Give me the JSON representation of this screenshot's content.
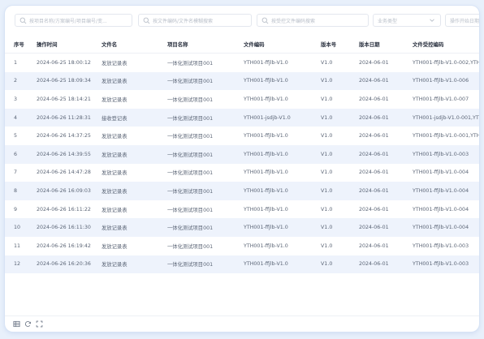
{
  "filters": {
    "project_placeholder": "按项目名称/方案编号/项目编号/变...",
    "file_placeholder": "按文件编码/文件名模糊搜索",
    "transfer_placeholder": "按受控文件编码搜索",
    "business_type_placeholder": "业务类型",
    "op_time_placeholder": "操作开始日期"
  },
  "table": {
    "headers": [
      "序号",
      "操作时间",
      "文件名",
      "项目名称",
      "文件编码",
      "版本号",
      "版本日期",
      "文件受控编码"
    ],
    "rows": [
      [
        "1",
        "2024-06-25 18:00:12",
        "发放记录表",
        "一体化测试项目001",
        "YTH001-ffjlb-V1.0",
        "V1.0",
        "2024-06-01",
        "YTH001-ffjlb-V1.0-002,YTH"
      ],
      [
        "2",
        "2024-06-25 18:09:34",
        "发放记录表",
        "一体化测试项目001",
        "YTH001-ffjlb-V1.0",
        "V1.0",
        "2024-06-01",
        "YTH001-ffjlb-V1.0-006"
      ],
      [
        "3",
        "2024-06-25 18:14:21",
        "发放记录表",
        "一体化测试项目001",
        "YTH001-ffjlb-V1.0",
        "V1.0",
        "2024-06-01",
        "YTH001-ffjlb-V1.0-007"
      ],
      [
        "4",
        "2024-06-26 11:28:31",
        "接收登记表",
        "一体化测试项目001",
        "YTH001-jsdjb-V1.0",
        "V1.0",
        "2024-06-01",
        "YTH001-jsdjb-V1.0-001,YTH"
      ],
      [
        "5",
        "2024-06-26 14:37:25",
        "发放记录表",
        "一体化测试项目001",
        "YTH001-ffjlb-V1.0",
        "V1.0",
        "2024-06-01",
        "YTH001-ffjlb-V1.0-001,YTH"
      ],
      [
        "6",
        "2024-06-26 14:39:55",
        "发放记录表",
        "一体化测试项目001",
        "YTH001-ffjlb-V1.0",
        "V1.0",
        "2024-06-01",
        "YTH001-ffjlb-V1.0-003"
      ],
      [
        "7",
        "2024-06-26 14:47:28",
        "发放记录表",
        "一体化测试项目001",
        "YTH001-ffjlb-V1.0",
        "V1.0",
        "2024-06-01",
        "YTH001-ffjlb-V1.0-004"
      ],
      [
        "8",
        "2024-06-26 16:09:03",
        "发放记录表",
        "一体化测试项目001",
        "YTH001-ffjlb-V1.0",
        "V1.0",
        "2024-06-01",
        "YTH001-ffjlb-V1.0-004"
      ],
      [
        "9",
        "2024-06-26 16:11:22",
        "发放记录表",
        "一体化测试项目001",
        "YTH001-ffjlb-V1.0",
        "V1.0",
        "2024-06-01",
        "YTH001-ffjlb-V1.0-004"
      ],
      [
        "10",
        "2024-06-26 16:11:30",
        "发放记录表",
        "一体化测试项目001",
        "YTH001-ffjlb-V1.0",
        "V1.0",
        "2024-06-01",
        "YTH001-ffjlb-V1.0-004"
      ],
      [
        "11",
        "2024-06-26 16:19:42",
        "发放记录表",
        "一体化测试项目001",
        "YTH001-ffjlb-V1.0",
        "V1.0",
        "2024-06-01",
        "YTH001-ffjlb-V1.0-003"
      ],
      [
        "12",
        "2024-06-26 16:20:36",
        "发放记录表",
        "一体化测试项目001",
        "YTH001-ffjlb-V1.0",
        "V1.0",
        "2024-06-01",
        "YTH001-ffjlb-V1.0-003"
      ]
    ]
  },
  "footer": {
    "icons": [
      "table-settings-icon",
      "refresh-icon",
      "fullscreen-icon"
    ]
  },
  "colors": {
    "accent": "#3b82f6",
    "row_stripe": "#eef3fc",
    "page_bg": "#e8f0fb"
  }
}
